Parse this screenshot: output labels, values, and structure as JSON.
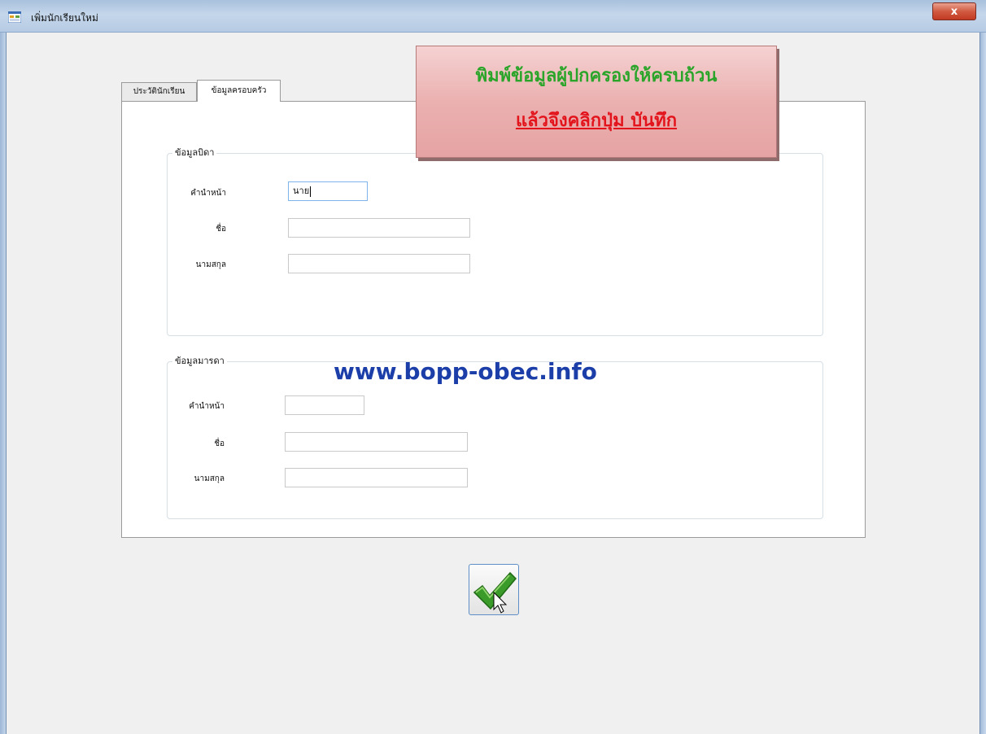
{
  "window": {
    "title": "เพิ่มนักเรียนใหม่",
    "close_label": "x"
  },
  "tabs": [
    {
      "label": "ประวัตินักเรียน",
      "active": false
    },
    {
      "label": "ข้อมูลครอบครัว",
      "active": true
    }
  ],
  "father": {
    "group_title": "ข้อมูลบิดา",
    "prefix_label": "คำนำหน้า",
    "prefix_value": "นาย",
    "first_name_label": "ชื่อ",
    "first_name_value": "",
    "last_name_label": "นามสกุล",
    "last_name_value": ""
  },
  "mother": {
    "group_title": "ข้อมูลมารดา",
    "prefix_label": "คำนำหน้า",
    "prefix_value": "",
    "first_name_label": "ชื่อ",
    "first_name_value": "",
    "last_name_label": "นามสกุล",
    "last_name_value": ""
  },
  "callout": {
    "line1": "พิมพ์ข้อมูลผู้ปกครองให้ครบถ้วน",
    "line2": "แล้วจึงคลิกปุ่ม บันทึก"
  },
  "watermark": "www.bopp-obec.info",
  "icons": {
    "app": "form-icon",
    "save": "checkmark-icon",
    "cursor": "mouse-pointer-icon"
  },
  "colors": {
    "callout_green": "#2aa52a",
    "callout_red": "#e3131b",
    "watermark_blue": "#1b3ea8",
    "check_green": "#3a9a2a"
  }
}
